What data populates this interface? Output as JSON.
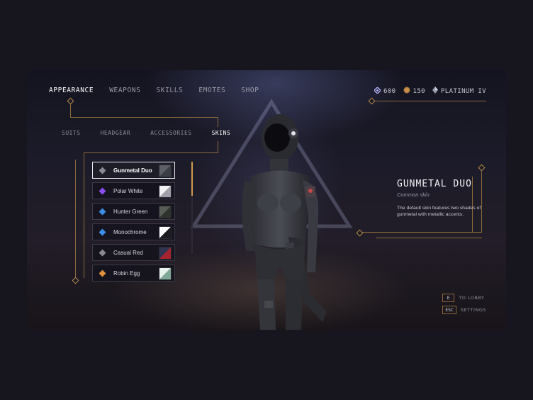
{
  "nav": {
    "tabs": [
      "APPEARANCE",
      "WEAPONS",
      "SKILLS",
      "EMOTES",
      "SHOP"
    ],
    "active": "APPEARANCE"
  },
  "subnav": {
    "tabs": [
      "SUITS",
      "HEADGEAR",
      "ACCESSORIES",
      "SKINS"
    ],
    "active": "SKINS"
  },
  "currency": {
    "crystals": "600",
    "coins": "150",
    "rank": "PLATINUM IV"
  },
  "skins": [
    {
      "name": "Gunmetal Duo",
      "marker": "#8a8a93",
      "swatch": [
        "#5c5f66",
        "#3b3e44"
      ],
      "active": true
    },
    {
      "name": "Polar White",
      "marker": "#8b4ef0",
      "swatch": [
        "#f2f2f4",
        "#9fa0a8"
      ],
      "active": false
    },
    {
      "name": "Hunter Green",
      "marker": "#3b8fe8",
      "swatch": [
        "#575c56",
        "#2f332f"
      ],
      "active": false
    },
    {
      "name": "Monochrome",
      "marker": "#3b8fe8",
      "swatch": [
        "#ffffff",
        "#1c1c20"
      ],
      "active": false
    },
    {
      "name": "Casual Red",
      "marker": "#8a8a93",
      "swatch": [
        "#2f3550",
        "#a5222f"
      ],
      "active": false
    },
    {
      "name": "Robin Egg",
      "marker": "#e0913d",
      "swatch": [
        "#e8f2ec",
        "#7fa898"
      ],
      "active": false
    }
  ],
  "detail": {
    "title": "GUNMETAL DUO",
    "rarity": "Common skin",
    "description": "The default skin features two shades of gunmetal with metallic accents."
  },
  "shortcuts": [
    {
      "key": "E",
      "label": "TO LOBBY"
    },
    {
      "key": "ESC",
      "label": "SETTINGS"
    }
  ],
  "colors": {
    "accent": "#d19a4e",
    "line": "#8c6a3a",
    "background": "#17161e"
  }
}
